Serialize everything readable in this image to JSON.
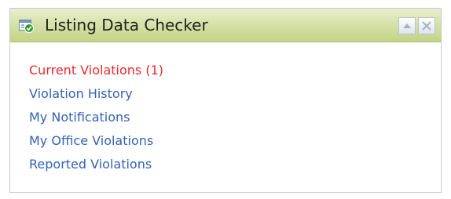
{
  "widget": {
    "title": "Listing Data Checker",
    "app_icon": "listing-checker-icon",
    "controls": {
      "collapse_icon": "triangle-up-icon",
      "close_icon": "close-icon"
    },
    "links": [
      {
        "label": "Current Violations (1)",
        "color": "#ee2a2a"
      },
      {
        "label": "Violation History",
        "color": "#3562b5"
      },
      {
        "label": "My Notifications",
        "color": "#3562b5"
      },
      {
        "label": "My Office Violations",
        "color": "#3562b5"
      },
      {
        "label": "Reported Violations",
        "color": "#3562b5"
      }
    ]
  },
  "colors": {
    "header_top": "#e9efcf",
    "header_bottom": "#c3d386",
    "link": "#3562b5",
    "alert": "#ee2a2a"
  }
}
